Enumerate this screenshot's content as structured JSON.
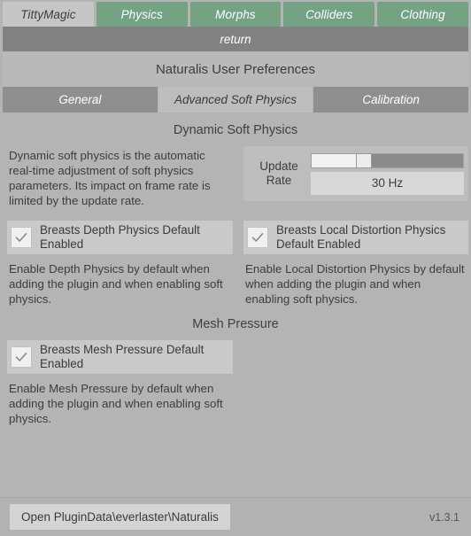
{
  "main_tabs": [
    {
      "label": "TittyMagic",
      "active": true
    },
    {
      "label": "Physics",
      "active": false
    },
    {
      "label": "Morphs",
      "active": false
    },
    {
      "label": "Colliders",
      "active": false
    },
    {
      "label": "Clothing",
      "active": false
    }
  ],
  "return_bar": {
    "label": "return"
  },
  "header": {
    "title": "Naturalis User Preferences"
  },
  "sub_tabs": [
    {
      "label": "General",
      "active": false
    },
    {
      "label": "Advanced Soft Physics",
      "active": true
    },
    {
      "label": "Calibration",
      "active": false
    }
  ],
  "sections": {
    "dynamic_soft_physics": {
      "heading": "Dynamic Soft Physics",
      "description": "Dynamic soft physics is the automatic real-time adjustment of soft physics parameters. Its impact on frame rate is limited by the update rate.",
      "slider": {
        "label_line1": "Update",
        "label_line2": "Rate",
        "value": "30 Hz",
        "fill_percent": 29
      },
      "checkboxes": [
        {
          "label": "Breasts Depth Physics Default Enabled",
          "checked": true,
          "description": "Enable Depth Physics by default when adding the plugin and when enabling soft physics."
        },
        {
          "label": "Breasts Local Distortion Physics Default Enabled",
          "checked": true,
          "description": "Enable Local Distortion Physics by default when adding the plugin and when enabling soft physics."
        }
      ]
    },
    "mesh_pressure": {
      "heading": "Mesh Pressure",
      "checkbox": {
        "label": "Breasts Mesh Pressure Default Enabled",
        "checked": true,
        "description": "Enable Mesh Pressure by default when adding the plugin and when enabling soft physics."
      }
    }
  },
  "footer": {
    "open_folder_label": "Open PluginData\\everlaster\\Naturalis",
    "version": "v1.3.1"
  },
  "colors": {
    "tab_active": "#c6c6c6",
    "tab_inactive_green": "#74a383",
    "panel_background": "#b4b4b4",
    "return_bar": "#828282",
    "widget_background": "#c9c9c9",
    "text_primary": "#3d3d3d"
  }
}
